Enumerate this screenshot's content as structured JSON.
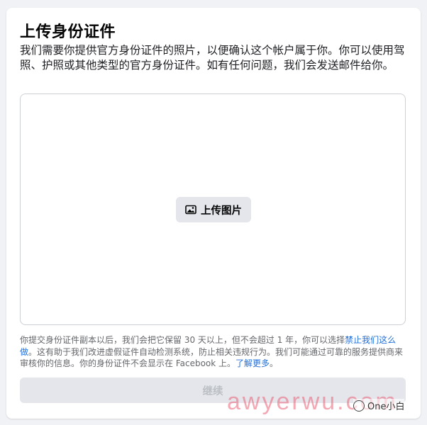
{
  "dialog": {
    "title": "上传身份证件",
    "description": "我们需要你提供官方身份证件的照片，以便确认这个帐户属于你。你可以使用驾照、护照或其他类型的官方身份证件。如有任何问题，我们会发送邮件给你。",
    "upload_button_label": "上传图片",
    "upload_icon": "photo-icon",
    "footnote_part1": "你提交身份证件副本以后，我们会把它保留 30 天以上，但不会超过 1 年，你可以选择",
    "footnote_link1": "禁止我们这么做",
    "footnote_part2": "。这有助于我们改进虚假证件自动检测系统，防止相关违规行为。我们可能通过可靠的服务提供商来审核你的信息。你的身份证件不会显示在 Facebook 上。",
    "footnote_link2": "了解更多",
    "footnote_part3": "。",
    "continue_button_label": "继续"
  },
  "watermark": {
    "text": "awyerwu.com",
    "badge_text": "One小白"
  },
  "colors": {
    "background": "#f0f2f5",
    "card": "#ffffff",
    "link": "#216fdb",
    "button_bg": "#e4e6eb",
    "disabled_text": "#bcc0c4"
  }
}
